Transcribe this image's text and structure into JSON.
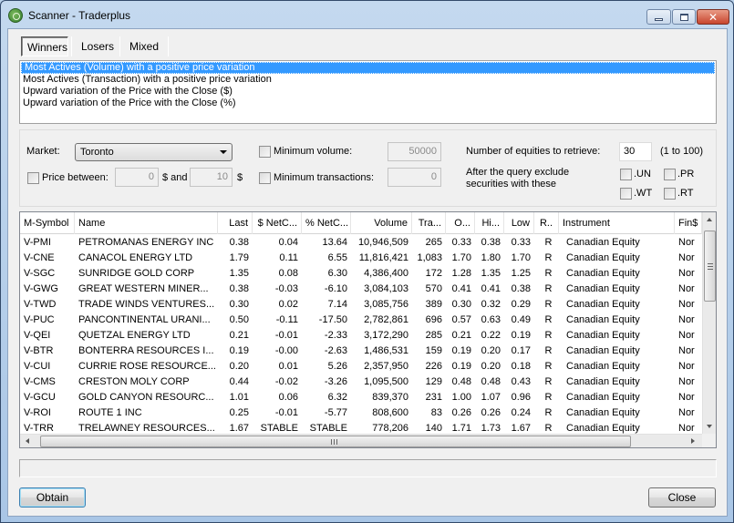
{
  "window": {
    "title": "Scanner - Traderplus",
    "icon": "app-logo-icon",
    "controls": {
      "minimize": "minimize-icon",
      "maximize": "maximize-icon",
      "close": "close-icon",
      "close_glyph": "✕"
    }
  },
  "tabs": [
    {
      "label": "Winners",
      "selected": true
    },
    {
      "label": "Losers",
      "selected": false
    },
    {
      "label": "Mixed",
      "selected": false
    }
  ],
  "queries": [
    {
      "label": "Most Actives (Volume) with a positive price variation",
      "selected": true
    },
    {
      "label": "Most Actives (Transaction) with a positive price variation",
      "selected": false
    },
    {
      "label": "Upward variation of the Price with the Close ($)",
      "selected": false
    },
    {
      "label": "Upward variation of the Price with the Close (%)",
      "selected": false
    }
  ],
  "filters": {
    "market_label": "Market:",
    "market_value": "Toronto",
    "price_between_label": "Price between:",
    "price_between_checked": false,
    "price_min": "0",
    "price_and_label": "$ and",
    "price_max": "10",
    "price_unit": "$",
    "min_volume_label": "Minimum volume:",
    "min_volume_checked": false,
    "min_volume_value": "50000",
    "min_transactions_label": "Minimum transactions:",
    "min_transactions_checked": false,
    "min_transactions_value": "0",
    "num_equities_label": "Number of equities to retrieve:",
    "num_equities_value": "30",
    "num_equities_range": "(1 to 100)",
    "exclude_label_line1": "After the query exclude",
    "exclude_label_line2": "securities with these",
    "exclude_options": [
      {
        "label": ".UN",
        "checked": false
      },
      {
        "label": ".PR",
        "checked": false
      },
      {
        "label": ".WT",
        "checked": false
      },
      {
        "label": ".RT",
        "checked": false
      }
    ]
  },
  "grid": {
    "columns": [
      "M-Symbol",
      "Name",
      "Last",
      "$ NetC...",
      "% NetC...",
      "Volume",
      "Tra...",
      "O...",
      "Hi...",
      "Low",
      "R..",
      "Instrument",
      "Fin$"
    ],
    "rows": [
      [
        "V-PMI",
        "PETROMANAS ENERGY INC",
        "0.38",
        "0.04",
        "13.64",
        "10,946,509",
        "265",
        "0.33",
        "0.38",
        "0.33",
        "R",
        "Canadian Equity",
        "Nor"
      ],
      [
        "V-CNE",
        "CANACOL ENERGY LTD",
        "1.79",
        "0.11",
        "6.55",
        "11,816,421",
        "1,083",
        "1.70",
        "1.80",
        "1.70",
        "R",
        "Canadian Equity",
        "Nor"
      ],
      [
        "V-SGC",
        "SUNRIDGE GOLD CORP",
        "1.35",
        "0.08",
        "6.30",
        "4,386,400",
        "172",
        "1.28",
        "1.35",
        "1.25",
        "R",
        "Canadian Equity",
        "Nor"
      ],
      [
        "V-GWG",
        "GREAT WESTERN MINER...",
        "0.38",
        "-0.03",
        "-6.10",
        "3,084,103",
        "570",
        "0.41",
        "0.41",
        "0.38",
        "R",
        "Canadian Equity",
        "Nor"
      ],
      [
        "V-TWD",
        "TRADE WINDS VENTURES...",
        "0.30",
        "0.02",
        "7.14",
        "3,085,756",
        "389",
        "0.30",
        "0.32",
        "0.29",
        "R",
        "Canadian Equity",
        "Nor"
      ],
      [
        "V-PUC",
        "PANCONTINENTAL URANI...",
        "0.50",
        "-0.11",
        "-17.50",
        "2,782,861",
        "696",
        "0.57",
        "0.63",
        "0.49",
        "R",
        "Canadian Equity",
        "Nor"
      ],
      [
        "V-QEI",
        "QUETZAL ENERGY LTD",
        "0.21",
        "-0.01",
        "-2.33",
        "3,172,290",
        "285",
        "0.21",
        "0.22",
        "0.19",
        "R",
        "Canadian Equity",
        "Nor"
      ],
      [
        "V-BTR",
        "BONTERRA RESOURCES I...",
        "0.19",
        "-0.00",
        "-2.63",
        "1,486,531",
        "159",
        "0.19",
        "0.20",
        "0.17",
        "R",
        "Canadian Equity",
        "Nor"
      ],
      [
        "V-CUI",
        "CURRIE ROSE RESOURCE...",
        "0.20",
        "0.01",
        "5.26",
        "2,357,950",
        "226",
        "0.19",
        "0.20",
        "0.18",
        "R",
        "Canadian Equity",
        "Nor"
      ],
      [
        "V-CMS",
        "CRESTON MOLY CORP",
        "0.44",
        "-0.02",
        "-3.26",
        "1,095,500",
        "129",
        "0.48",
        "0.48",
        "0.43",
        "R",
        "Canadian Equity",
        "Nor"
      ],
      [
        "V-GCU",
        "GOLD CANYON RESOURC...",
        "1.01",
        "0.06",
        "6.32",
        "839,370",
        "231",
        "1.00",
        "1.07",
        "0.96",
        "R",
        "Canadian Equity",
        "Nor"
      ],
      [
        "V-ROI",
        "ROUTE 1 INC",
        "0.25",
        "-0.01",
        "-5.77",
        "808,600",
        "83",
        "0.26",
        "0.26",
        "0.24",
        "R",
        "Canadian Equity",
        "Nor"
      ],
      [
        "V-TRR",
        "TRELAWNEY RESOURCES...",
        "1.67",
        "STABLE",
        "STABLE",
        "778,206",
        "140",
        "1.71",
        "1.73",
        "1.67",
        "R",
        "Canadian Equity",
        "Nor"
      ]
    ]
  },
  "status_text": "",
  "buttons": {
    "obtain": "Obtain",
    "close": "Close"
  }
}
